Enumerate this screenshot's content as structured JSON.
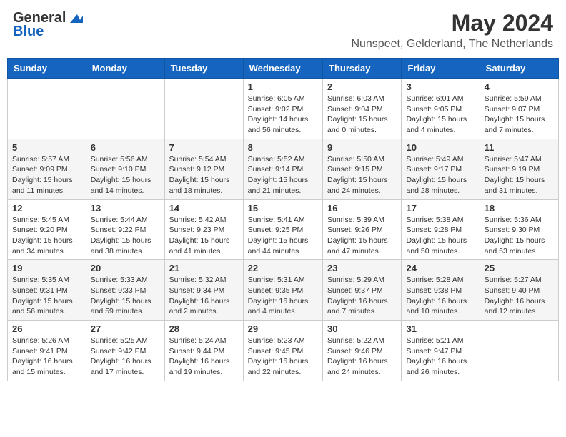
{
  "logo": {
    "general": "General",
    "blue": "Blue"
  },
  "title": "May 2024",
  "location": "Nunspeet, Gelderland, The Netherlands",
  "days_of_week": [
    "Sunday",
    "Monday",
    "Tuesday",
    "Wednesday",
    "Thursday",
    "Friday",
    "Saturday"
  ],
  "weeks": [
    [
      {
        "day": "",
        "info": ""
      },
      {
        "day": "",
        "info": ""
      },
      {
        "day": "",
        "info": ""
      },
      {
        "day": "1",
        "info": "Sunrise: 6:05 AM\nSunset: 9:02 PM\nDaylight: 14 hours and 56 minutes."
      },
      {
        "day": "2",
        "info": "Sunrise: 6:03 AM\nSunset: 9:04 PM\nDaylight: 15 hours and 0 minutes."
      },
      {
        "day": "3",
        "info": "Sunrise: 6:01 AM\nSunset: 9:05 PM\nDaylight: 15 hours and 4 minutes."
      },
      {
        "day": "4",
        "info": "Sunrise: 5:59 AM\nSunset: 9:07 PM\nDaylight: 15 hours and 7 minutes."
      }
    ],
    [
      {
        "day": "5",
        "info": "Sunrise: 5:57 AM\nSunset: 9:09 PM\nDaylight: 15 hours and 11 minutes."
      },
      {
        "day": "6",
        "info": "Sunrise: 5:56 AM\nSunset: 9:10 PM\nDaylight: 15 hours and 14 minutes."
      },
      {
        "day": "7",
        "info": "Sunrise: 5:54 AM\nSunset: 9:12 PM\nDaylight: 15 hours and 18 minutes."
      },
      {
        "day": "8",
        "info": "Sunrise: 5:52 AM\nSunset: 9:14 PM\nDaylight: 15 hours and 21 minutes."
      },
      {
        "day": "9",
        "info": "Sunrise: 5:50 AM\nSunset: 9:15 PM\nDaylight: 15 hours and 24 minutes."
      },
      {
        "day": "10",
        "info": "Sunrise: 5:49 AM\nSunset: 9:17 PM\nDaylight: 15 hours and 28 minutes."
      },
      {
        "day": "11",
        "info": "Sunrise: 5:47 AM\nSunset: 9:19 PM\nDaylight: 15 hours and 31 minutes."
      }
    ],
    [
      {
        "day": "12",
        "info": "Sunrise: 5:45 AM\nSunset: 9:20 PM\nDaylight: 15 hours and 34 minutes."
      },
      {
        "day": "13",
        "info": "Sunrise: 5:44 AM\nSunset: 9:22 PM\nDaylight: 15 hours and 38 minutes."
      },
      {
        "day": "14",
        "info": "Sunrise: 5:42 AM\nSunset: 9:23 PM\nDaylight: 15 hours and 41 minutes."
      },
      {
        "day": "15",
        "info": "Sunrise: 5:41 AM\nSunset: 9:25 PM\nDaylight: 15 hours and 44 minutes."
      },
      {
        "day": "16",
        "info": "Sunrise: 5:39 AM\nSunset: 9:26 PM\nDaylight: 15 hours and 47 minutes."
      },
      {
        "day": "17",
        "info": "Sunrise: 5:38 AM\nSunset: 9:28 PM\nDaylight: 15 hours and 50 minutes."
      },
      {
        "day": "18",
        "info": "Sunrise: 5:36 AM\nSunset: 9:30 PM\nDaylight: 15 hours and 53 minutes."
      }
    ],
    [
      {
        "day": "19",
        "info": "Sunrise: 5:35 AM\nSunset: 9:31 PM\nDaylight: 15 hours and 56 minutes."
      },
      {
        "day": "20",
        "info": "Sunrise: 5:33 AM\nSunset: 9:33 PM\nDaylight: 15 hours and 59 minutes."
      },
      {
        "day": "21",
        "info": "Sunrise: 5:32 AM\nSunset: 9:34 PM\nDaylight: 16 hours and 2 minutes."
      },
      {
        "day": "22",
        "info": "Sunrise: 5:31 AM\nSunset: 9:35 PM\nDaylight: 16 hours and 4 minutes."
      },
      {
        "day": "23",
        "info": "Sunrise: 5:29 AM\nSunset: 9:37 PM\nDaylight: 16 hours and 7 minutes."
      },
      {
        "day": "24",
        "info": "Sunrise: 5:28 AM\nSunset: 9:38 PM\nDaylight: 16 hours and 10 minutes."
      },
      {
        "day": "25",
        "info": "Sunrise: 5:27 AM\nSunset: 9:40 PM\nDaylight: 16 hours and 12 minutes."
      }
    ],
    [
      {
        "day": "26",
        "info": "Sunrise: 5:26 AM\nSunset: 9:41 PM\nDaylight: 16 hours and 15 minutes."
      },
      {
        "day": "27",
        "info": "Sunrise: 5:25 AM\nSunset: 9:42 PM\nDaylight: 16 hours and 17 minutes."
      },
      {
        "day": "28",
        "info": "Sunrise: 5:24 AM\nSunset: 9:44 PM\nDaylight: 16 hours and 19 minutes."
      },
      {
        "day": "29",
        "info": "Sunrise: 5:23 AM\nSunset: 9:45 PM\nDaylight: 16 hours and 22 minutes."
      },
      {
        "day": "30",
        "info": "Sunrise: 5:22 AM\nSunset: 9:46 PM\nDaylight: 16 hours and 24 minutes."
      },
      {
        "day": "31",
        "info": "Sunrise: 5:21 AM\nSunset: 9:47 PM\nDaylight: 16 hours and 26 minutes."
      },
      {
        "day": "",
        "info": ""
      }
    ]
  ]
}
